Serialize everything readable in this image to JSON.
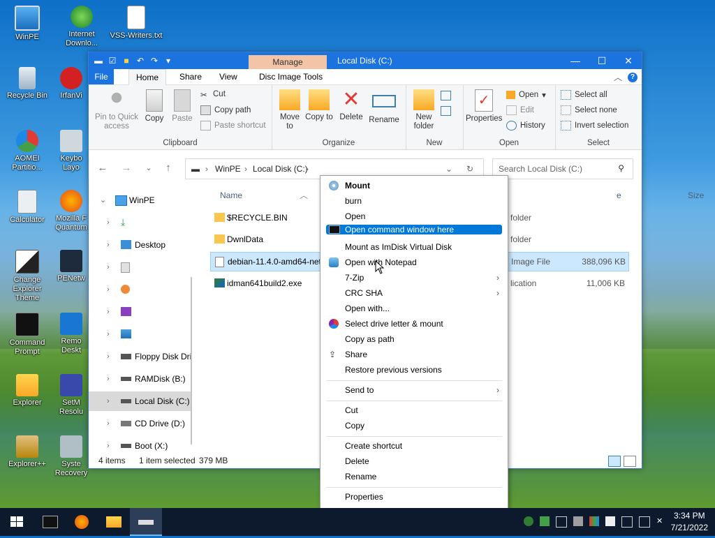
{
  "desktop": {
    "icons": [
      {
        "label": "WinPE"
      },
      {
        "label": "Internet Downlo..."
      },
      {
        "label": "VSS-Writers.txt"
      },
      {
        "label": "Recycle Bin"
      },
      {
        "label": "IrfanVi"
      },
      {
        "label": "AOMEI Partitio..."
      },
      {
        "label": "Keybo Layo"
      },
      {
        "label": "Calculator"
      },
      {
        "label": "Mozilla F Quantum"
      },
      {
        "label": "Change Explorer Theme"
      },
      {
        "label": "PENetw"
      },
      {
        "label": "Command Prompt"
      },
      {
        "label": "Remo Deskt"
      },
      {
        "label": "Explorer"
      },
      {
        "label": "SetM Resolu"
      },
      {
        "label": "Explorer++"
      },
      {
        "label": "Syste Recovery"
      }
    ]
  },
  "window": {
    "title": "Local Disk (C:)",
    "manage_tab": "Manage",
    "tabs": {
      "file": "File",
      "home": "Home",
      "share": "Share",
      "view": "View",
      "disc": "Disc Image Tools"
    },
    "ribbon": {
      "clipboard": {
        "pin": "Pin to Quick access",
        "copy": "Copy",
        "paste": "Paste",
        "cut": "Cut",
        "copy_path": "Copy path",
        "paste_shortcut": "Paste shortcut",
        "label": "Clipboard"
      },
      "organize": {
        "move_to": "Move to",
        "copy_to": "Copy to",
        "delete": "Delete",
        "rename": "Rename",
        "label": "Organize"
      },
      "new": {
        "new_folder": "New folder",
        "label": "New"
      },
      "open": {
        "properties": "Properties",
        "open": "Open",
        "edit": "Edit",
        "history": "History",
        "label": "Open"
      },
      "select": {
        "select_all": "Select all",
        "select_none": "Select none",
        "invert": "Invert selection",
        "label": "Select"
      }
    },
    "address": {
      "root": "WinPE",
      "current": "Local Disk (C:)"
    },
    "search_placeholder": "Search Local Disk (C:)",
    "nav": [
      {
        "label": "WinPE"
      },
      {
        "label": ""
      },
      {
        "label": "Desktop"
      },
      {
        "label": ""
      },
      {
        "label": ""
      },
      {
        "label": ""
      },
      {
        "label": ""
      },
      {
        "label": "Floppy Disk Dri"
      },
      {
        "label": "RAMDisk (B:)"
      },
      {
        "label": "Local Disk (C:)"
      },
      {
        "label": "CD Drive (D:)"
      },
      {
        "label": "Boot (X:)"
      }
    ],
    "columns": {
      "name": "Name",
      "type": "e",
      "size": "Size"
    },
    "files": [
      {
        "name": "$RECYCLE.BIN",
        "type": "folder",
        "size": ""
      },
      {
        "name": "DwnlData",
        "type": "folder",
        "size": ""
      },
      {
        "name": "debian-11.4.0-amd64-netinst",
        "type": "Image File",
        "size": "388,096 KB"
      },
      {
        "name": "idman641build2.exe",
        "type": "lication",
        "size": "11,006 KB"
      }
    ],
    "status": {
      "items": "4 items",
      "selected": "1 item selected",
      "size": "379 MB"
    }
  },
  "context_menu": {
    "items": [
      {
        "label": "Mount"
      },
      {
        "label": "burn"
      },
      {
        "label": "Open"
      },
      {
        "label": "Open command window here"
      },
      {
        "label": "Mount as ImDisk Virtual Disk"
      },
      {
        "label": "Open with Notepad"
      },
      {
        "label": "7-Zip"
      },
      {
        "label": "CRC SHA"
      },
      {
        "label": "Open with..."
      },
      {
        "label": "Select drive letter & mount"
      },
      {
        "label": "Copy as path"
      },
      {
        "label": "Share"
      },
      {
        "label": "Restore previous versions"
      },
      {
        "label": "Send to"
      },
      {
        "label": "Cut"
      },
      {
        "label": "Copy"
      },
      {
        "label": "Create shortcut"
      },
      {
        "label": "Delete"
      },
      {
        "label": "Rename"
      },
      {
        "label": "Properties"
      }
    ]
  },
  "taskbar": {
    "time": "3:34 PM",
    "date": "7/21/2022"
  },
  "colors": {
    "accent": "#0078d7",
    "titlebar": "#1b73e0",
    "manage_tab": "#f3c4a6",
    "selection": "#cce8ff",
    "taskbar": "#0d1a2d"
  }
}
